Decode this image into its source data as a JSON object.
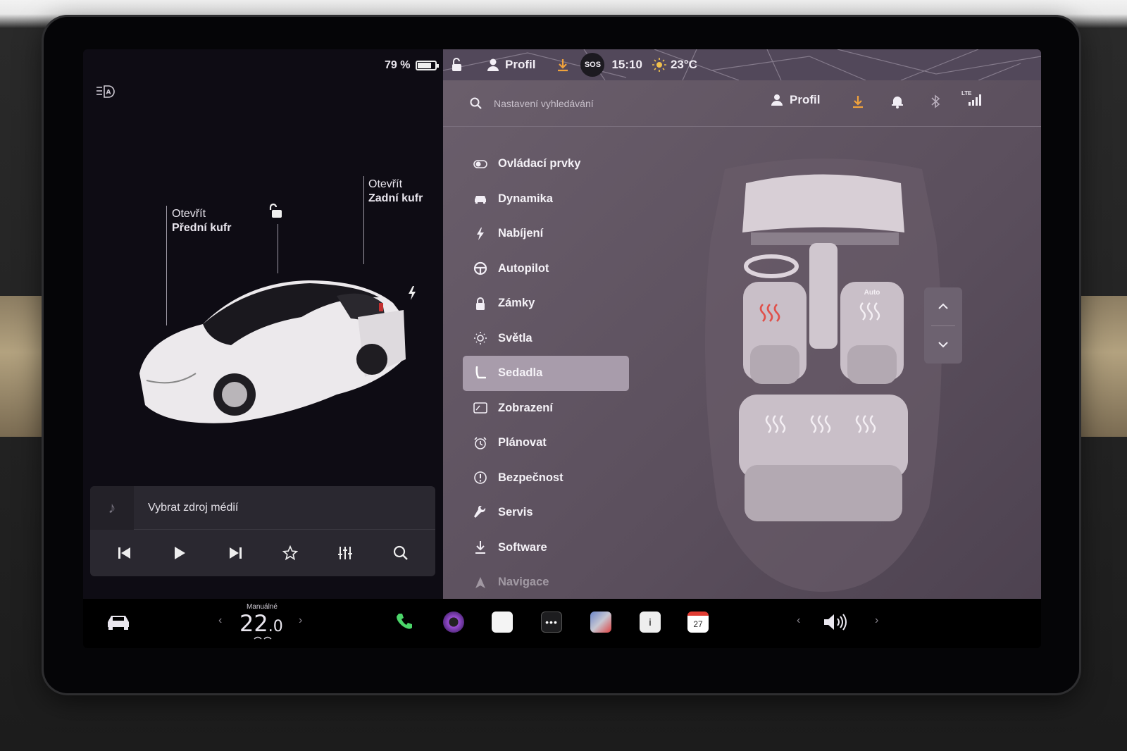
{
  "status": {
    "battery_percent": "79 %",
    "battery_level": 0.79,
    "profile": "Profil",
    "sos": "SOS",
    "time": "15:10",
    "temperature": "23°C"
  },
  "left_panel": {
    "front_trunk": {
      "action": "Otevřít",
      "label": "Přední kufr"
    },
    "rear_trunk": {
      "action": "Otevřít",
      "label": "Zadní kufr"
    },
    "media_source": "Vybrat zdroj médií"
  },
  "search": {
    "placeholder": "Nastavení vyhledávání"
  },
  "header": {
    "profile": "Profil",
    "network": "LTE"
  },
  "menu": [
    {
      "label": "Ovládací prvky",
      "icon": "toggle-icon"
    },
    {
      "label": "Dynamika",
      "icon": "car-icon"
    },
    {
      "label": "Nabíjení",
      "icon": "bolt-icon"
    },
    {
      "label": "Autopilot",
      "icon": "steering-wheel-icon"
    },
    {
      "label": "Zámky",
      "icon": "lock-icon"
    },
    {
      "label": "Světla",
      "icon": "sun-icon"
    },
    {
      "label": "Sedadla",
      "icon": "seat-icon",
      "active": true
    },
    {
      "label": "Zobrazení",
      "icon": "display-icon"
    },
    {
      "label": "Plánovat",
      "icon": "clock-icon"
    },
    {
      "label": "Bezpečnost",
      "icon": "alert-icon"
    },
    {
      "label": "Servis",
      "icon": "wrench-icon"
    },
    {
      "label": "Software",
      "icon": "download-icon"
    },
    {
      "label": "Navigace",
      "icon": "navigation-icon"
    }
  ],
  "seats": {
    "passenger_mode": "Auto"
  },
  "climate": {
    "mode": "Manuálné",
    "temp_whole": "22",
    "temp_decimal": ".0"
  },
  "dock": {
    "calendar_day": "27"
  },
  "colors": {
    "accent": "#f0a23c",
    "active_menu": "#a89cab",
    "seat_heat": "#e0504a"
  }
}
